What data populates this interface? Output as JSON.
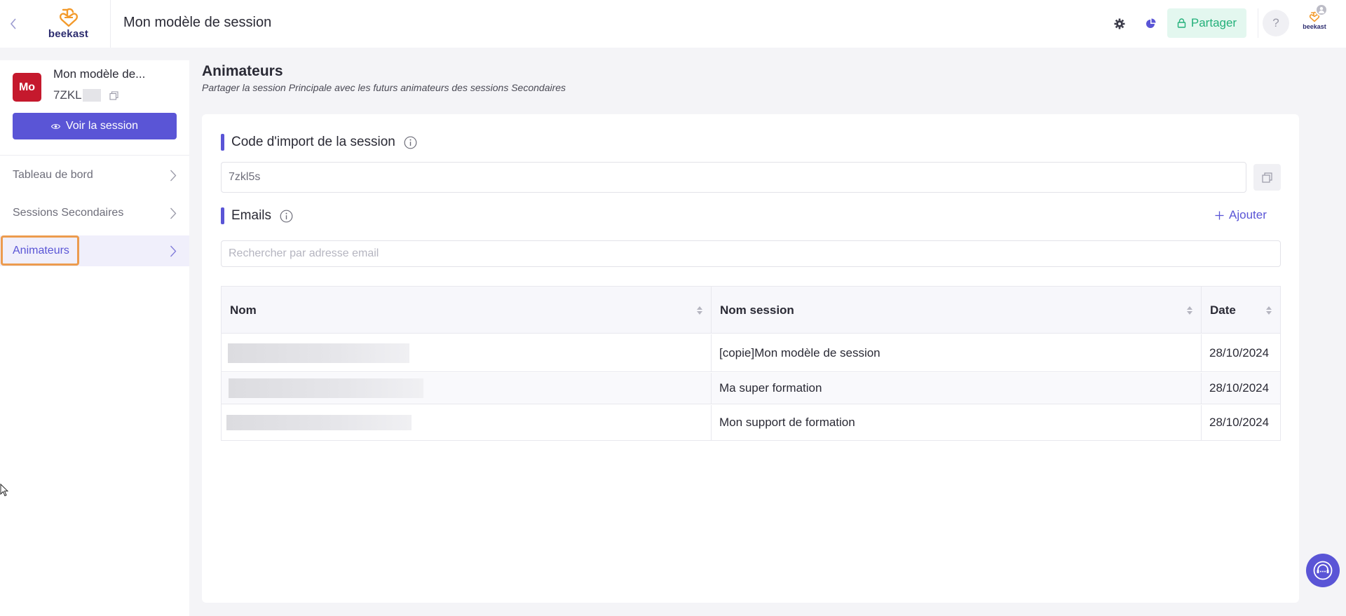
{
  "header": {
    "back_icon": "chevron-left-icon",
    "logo_text": "beekast",
    "title": "Mon modèle de session",
    "settings_icon": "gear-icon",
    "stats_icon": "pie-chart-icon",
    "share_label": "Partager",
    "share_icon": "lock-icon",
    "help_label": "?",
    "account_logo_text": "beekast"
  },
  "sidebar": {
    "session_avatar": "Mo",
    "session_name": "Mon modèle de...",
    "session_code": "7ZKL",
    "view_button": "Voir la session",
    "items": [
      {
        "label": "Tableau de bord"
      },
      {
        "label": "Sessions Secondaires"
      },
      {
        "label": "Animateurs"
      }
    ]
  },
  "main": {
    "title": "Animateurs",
    "subtitle": "Partager la session Principale avec les futurs animateurs des sessions Secondaires",
    "import_code": {
      "label": "Code d'import de la session",
      "value": "7zkl5s"
    },
    "emails": {
      "label": "Emails",
      "add_label": "Ajouter",
      "search_placeholder": "Rechercher par adresse email"
    },
    "table": {
      "columns": [
        "Nom",
        "Nom session",
        "Date"
      ],
      "rows": [
        {
          "session": "[copie]Mon modèle de session",
          "date": "28/10/2024"
        },
        {
          "session": "Ma super formation",
          "date": "28/10/2024"
        },
        {
          "session": "Mon support de formation",
          "date": "28/10/2024"
        }
      ]
    }
  },
  "colors": {
    "accent": "#5a55d6",
    "share_green": "#23b07a",
    "avatar_red": "#c5192d",
    "logo_orange": "#f39a2b",
    "focus_outline": "#ec9b4e"
  }
}
